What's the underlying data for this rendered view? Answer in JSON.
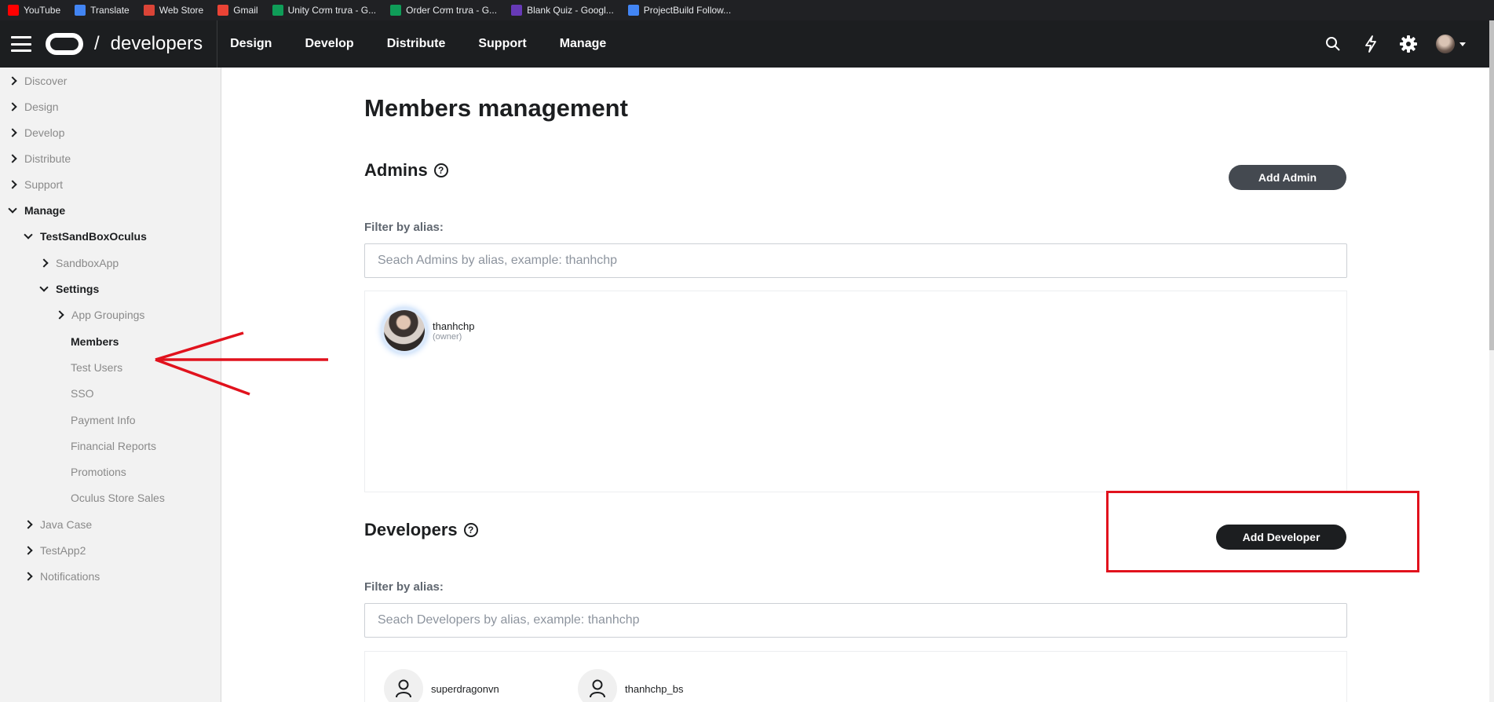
{
  "bookmarks": [
    {
      "label": "YouTube",
      "color": "#ff0000"
    },
    {
      "label": "Translate",
      "color": "#4285f4"
    },
    {
      "label": "Web Store",
      "color": "#db4437"
    },
    {
      "label": "Gmail",
      "color": "#ea4335"
    },
    {
      "label": "Unity Cơm trưa - G...",
      "color": "#0f9d58"
    },
    {
      "label": "Order Cơm trưa - G...",
      "color": "#0f9d58"
    },
    {
      "label": "Blank Quiz - Googl...",
      "color": "#673ab7"
    },
    {
      "label": "ProjectBuild Follow...",
      "color": "#4285f4"
    }
  ],
  "topnav": {
    "brand": "developers",
    "slash": "/",
    "links": [
      "Design",
      "Develop",
      "Distribute",
      "Support",
      "Manage"
    ],
    "icons": [
      "search-icon",
      "lightning-icon",
      "gear-icon",
      "avatar"
    ]
  },
  "sidebar": {
    "items": [
      {
        "label": "Discover",
        "level": 0,
        "state": "collapsed"
      },
      {
        "label": "Design",
        "level": 0,
        "state": "collapsed"
      },
      {
        "label": "Develop",
        "level": 0,
        "state": "collapsed"
      },
      {
        "label": "Distribute",
        "level": 0,
        "state": "collapsed"
      },
      {
        "label": "Support",
        "level": 0,
        "state": "collapsed"
      },
      {
        "label": "Manage",
        "level": 0,
        "state": "expanded"
      },
      {
        "label": "TestSandBoxOculus",
        "level": 1,
        "state": "expanded"
      },
      {
        "label": "SandboxApp",
        "level": 2,
        "state": "collapsed"
      },
      {
        "label": "Settings",
        "level": 2,
        "state": "expanded"
      },
      {
        "label": "App Groupings",
        "level": 3,
        "state": "collapsed"
      },
      {
        "label": "Members",
        "level": 3,
        "state": "active"
      },
      {
        "label": "Test Users",
        "level": 3,
        "state": "leaf"
      },
      {
        "label": "SSO",
        "level": 3,
        "state": "leaf"
      },
      {
        "label": "Payment Info",
        "level": 3,
        "state": "leaf"
      },
      {
        "label": "Financial Reports",
        "level": 3,
        "state": "leaf"
      },
      {
        "label": "Promotions",
        "level": 3,
        "state": "leaf"
      },
      {
        "label": "Oculus Store Sales",
        "level": 3,
        "state": "leaf"
      },
      {
        "label": "Java Case",
        "level": 1,
        "state": "collapsed"
      },
      {
        "label": "TestApp2",
        "level": 1,
        "state": "collapsed"
      },
      {
        "label": "Notifications",
        "level": 1,
        "state": "collapsed"
      }
    ]
  },
  "main": {
    "title": "Members management",
    "admins": {
      "heading": "Admins",
      "help": "?",
      "add_button": "Add Admin",
      "filter_label": "Filter by alias:",
      "filter_placeholder": "Seach Admins by alias, example: thanhchp",
      "members": [
        {
          "name": "thanhchp",
          "role": "(owner)"
        }
      ]
    },
    "developers": {
      "heading": "Developers",
      "help": "?",
      "add_button": "Add Developer",
      "filter_label": "Filter by alias:",
      "filter_placeholder": "Seach Developers by alias, example: thanhchp",
      "members": [
        {
          "name": "superdragonvn"
        },
        {
          "name": "thanhchp_bs"
        }
      ]
    }
  },
  "annotation_color": "#e1121d"
}
